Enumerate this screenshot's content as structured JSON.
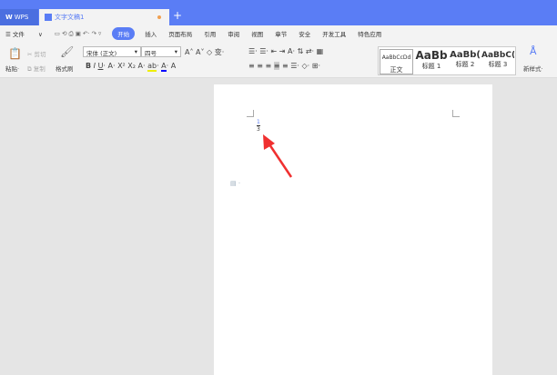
{
  "tabs": {
    "app": "WPS",
    "document": "文字文稿1",
    "new_tab": "+"
  },
  "menu": {
    "file": "文件",
    "items": [
      "开始",
      "插入",
      "页面布局",
      "引用",
      "审阅",
      "视图",
      "章节",
      "安全",
      "开发工具",
      "特色应用"
    ]
  },
  "ribbon": {
    "paste": "粘贴",
    "cut": "剪切",
    "copy": "复制",
    "format_painter": "格式刷",
    "font": "宋体 (正文)",
    "size": "四号",
    "new_style": "新样式",
    "styles": [
      {
        "preview": "AaBbCcDd",
        "label": "正文"
      },
      {
        "preview": "AaBb",
        "label": "标题 1"
      },
      {
        "preview": "AaBb(",
        "label": "标题 2"
      },
      {
        "preview": "AaBbC(",
        "label": "标题 3"
      }
    ]
  },
  "document": {
    "numerator": "1",
    "denominator": "3"
  },
  "colors": {
    "accent": "#5a7df5",
    "arrow": "#f03030"
  }
}
